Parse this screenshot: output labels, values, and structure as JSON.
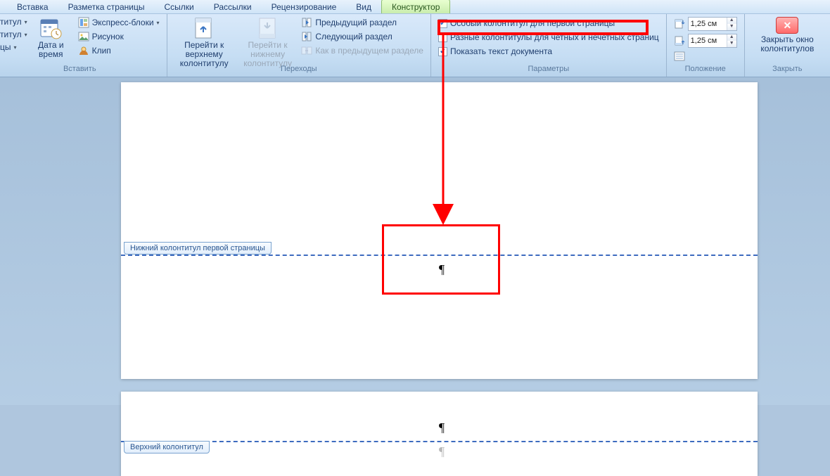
{
  "tabs": [
    "Вставка",
    "Разметка страницы",
    "Ссылки",
    "Рассылки",
    "Рецензирование",
    "Вид",
    "Конструктор"
  ],
  "activeTab": "Конструктор",
  "ribbon": {
    "insert": {
      "label": "Вставить",
      "col1": [
        "титул",
        "титул",
        "цы"
      ],
      "datetime": "Дата и время",
      "quickparts": "Экспресс-блоки",
      "picture": "Рисунок",
      "clip": "Клип"
    },
    "nav": {
      "label": "Переходы",
      "gotoHeader": "Перейти к верхнему колонтитулу",
      "gotoFooter": "Перейти к нижнему колонтитулу",
      "prevSection": "Предыдущий раздел",
      "nextSection": "Следующий раздел",
      "sameAsPrev": "Как в предыдущем разделе"
    },
    "opts": {
      "label": "Параметры",
      "firstPage": "Особый колонтитул для первой страницы",
      "oddEven": "Разные колонтитулы для четных и нечетных страниц",
      "showDoc": "Показать текст документа",
      "firstPageChecked": true,
      "oddEvenChecked": false,
      "showDocChecked": true
    },
    "pos": {
      "label": "Положение",
      "top": "1,25 см",
      "bottom": "1,25 см"
    },
    "close": {
      "label": "Закрыть",
      "btn": "Закрыть окно колонтитулов"
    }
  },
  "doc": {
    "footerTab1": "Нижний колонтитул первой страницы",
    "headerTab2": "Верхний колонтитул"
  }
}
